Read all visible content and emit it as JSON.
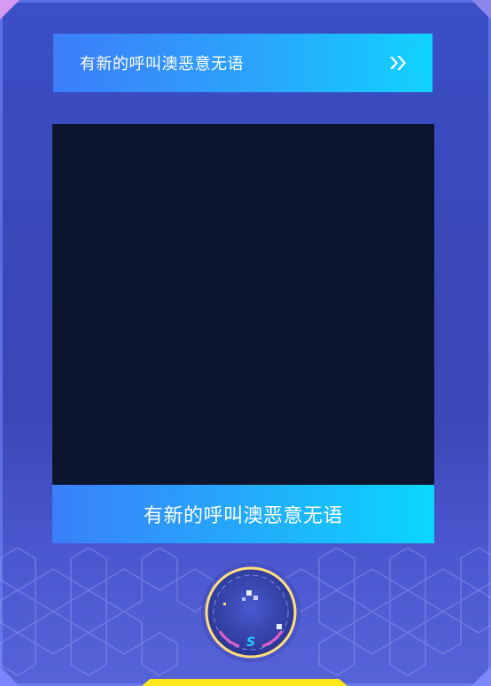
{
  "banner_top": {
    "label": "有新的呼叫澳恶意无语",
    "arrow_icon": "double-chevron-right-icon"
  },
  "video": {
    "state": "empty"
  },
  "banner_bottom": {
    "label": "有新的呼叫澳恶意无语"
  },
  "dial": {
    "letter": "S"
  },
  "colors": {
    "background": "#3b4fc7",
    "banner_start": "#3d7dfa",
    "banner_end": "#10d3ff",
    "video_bg": "#0c1530",
    "dial_ring": "#ffe07a",
    "dial_accent": "#e05cc8",
    "bottom_tab": "#ffe81a"
  }
}
